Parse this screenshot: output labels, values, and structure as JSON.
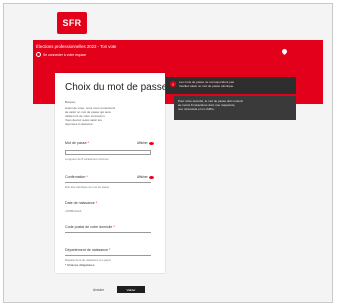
{
  "brand": {
    "logo_text": "SFR",
    "accent_color": "#e3001b"
  },
  "banner": {
    "title": "Élections professionnelles 2023 - Ton vote",
    "subtitle": "Se connecter à votre espace"
  },
  "form": {
    "title": "Choix du mot de passe",
    "intro": [
      "Bonjour,",
      "Avant de voter, nous vous remercions",
      "de saisir un mot de passe qui sera",
      "utilisé lors de votre connexion.",
      "Vous devrez aussi saisir les",
      "réponses ci-dessous."
    ],
    "password_label": "Mot de passe",
    "show_label": "Afficher",
    "password_hint": "Longueur de 8 caractères minimum",
    "confirm_label": "Confirmation",
    "confirm_hint": "Doit être identique au mot de passe",
    "birthdate_label": "Date de naissance",
    "birthdate_placeholder": "JJ/MM/AAAA",
    "city_label": "Code postal de votre domicile",
    "birthplace_label": "Département de naissance",
    "birthplace_hint": "Département de naissance (ou pays)",
    "required_note": "* Champs obligatoires",
    "cancel_label": "Annuler",
    "submit_label": "Valider"
  },
  "alert": {
    "icon": "error-icon",
    "lines": [
      "Les mots de passe ne correspondent pas",
      "Veuillez saisir un mot de passe identique."
    ]
  },
  "tip": {
    "lines": [
      "Pour votre sécurité, le mot de passe doit contenir",
      "au moins 8 caractères dont une majuscule,",
      "une minuscule et un chiffre."
    ]
  }
}
